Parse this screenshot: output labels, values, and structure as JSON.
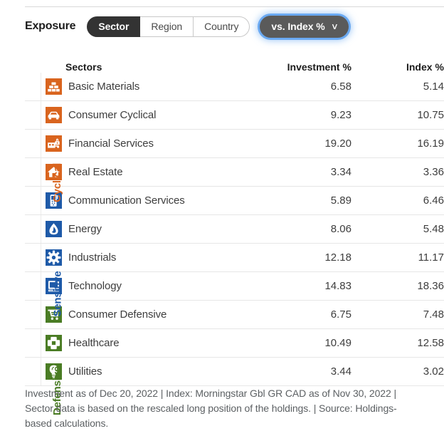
{
  "header": {
    "title": "Exposure",
    "segmented": [
      {
        "label": "Sector",
        "active": true
      },
      {
        "label": "Region",
        "active": false
      },
      {
        "label": "Country",
        "active": false
      }
    ],
    "index_dropdown": {
      "label": "vs. Index %",
      "caret": "∨"
    }
  },
  "table": {
    "columns": {
      "sector": "Sectors",
      "investment": "Investment",
      "investment_unit": "%",
      "index": "Index",
      "index_unit": "%"
    },
    "groups": [
      {
        "name": "Cyclical",
        "color": "#d9641e",
        "rows": 4
      },
      {
        "name": "Sensitive",
        "color": "#1e5aa8",
        "rows": 4
      },
      {
        "name": "Defensive",
        "color": "#4a7c24",
        "rows": 3
      }
    ],
    "rows": [
      {
        "group": "Cyclical",
        "icon": "basic-materials-icon",
        "name": "Basic Materials",
        "investment": "6.58",
        "index": "5.14"
      },
      {
        "group": "Cyclical",
        "icon": "consumer-cyclical-icon",
        "name": "Consumer Cyclical",
        "investment": "9.23",
        "index": "10.75"
      },
      {
        "group": "Cyclical",
        "icon": "financial-services-icon",
        "name": "Financial Services",
        "investment": "19.20",
        "index": "16.19"
      },
      {
        "group": "Cyclical",
        "icon": "real-estate-icon",
        "name": "Real Estate",
        "investment": "3.34",
        "index": "3.36"
      },
      {
        "group": "Sensitive",
        "icon": "communication-services-icon",
        "name": "Communication Services",
        "investment": "5.89",
        "index": "6.46"
      },
      {
        "group": "Sensitive",
        "icon": "energy-icon",
        "name": "Energy",
        "investment": "8.06",
        "index": "5.48"
      },
      {
        "group": "Sensitive",
        "icon": "industrials-icon",
        "name": "Industrials",
        "investment": "12.18",
        "index": "11.17"
      },
      {
        "group": "Sensitive",
        "icon": "technology-icon",
        "name": "Technology",
        "investment": "14.83",
        "index": "18.36"
      },
      {
        "group": "Defensive",
        "icon": "consumer-defensive-icon",
        "name": "Consumer Defensive",
        "investment": "6.75",
        "index": "7.48"
      },
      {
        "group": "Defensive",
        "icon": "healthcare-icon",
        "name": "Healthcare",
        "investment": "10.49",
        "index": "12.58"
      },
      {
        "group": "Defensive",
        "icon": "utilities-icon",
        "name": "Utilities",
        "investment": "3.44",
        "index": "3.02"
      }
    ]
  },
  "footnote": "Investment as of Dec 20, 2022 | Index: Morningstar Gbl GR CAD as of Nov 30, 2022 | Sector data is based on the rescaled long position of the holdings. | Source: Holdings-based calculations.",
  "colors": {
    "cyclical": "#e8761f",
    "sensitive": "#1f5fad",
    "defensive": "#4f8a26",
    "active_tab": "#333333",
    "dropdown": "#5a5a5a",
    "focus_ring": "#5aa0f0"
  }
}
